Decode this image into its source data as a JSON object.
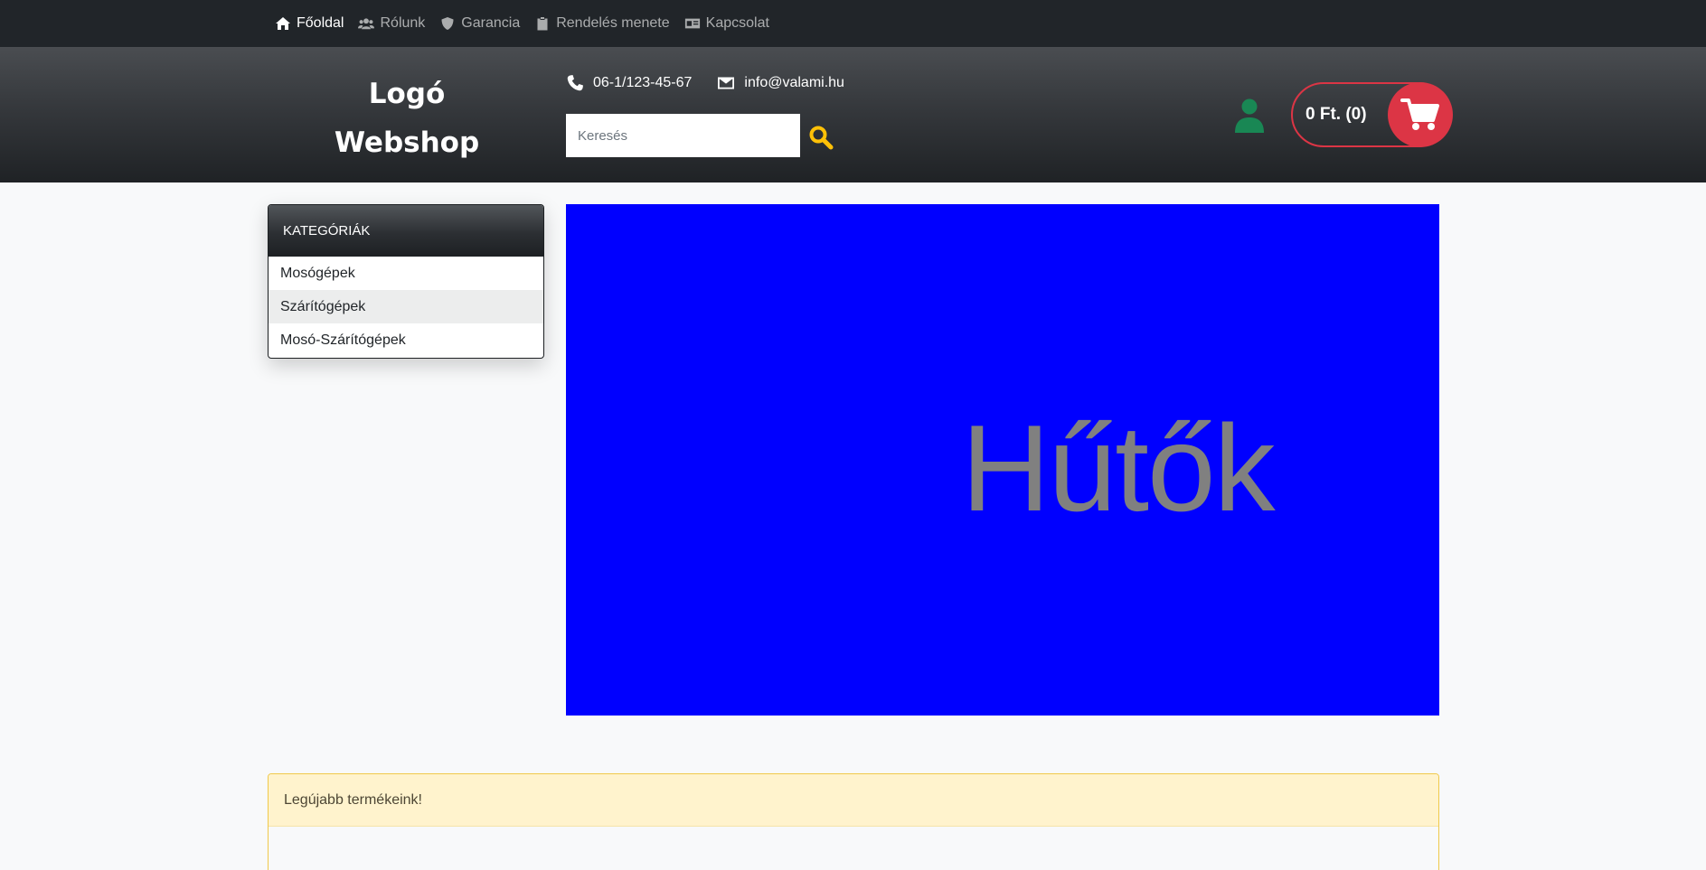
{
  "topnav": {
    "items": [
      {
        "label": "Főoldal",
        "icon": "home-icon",
        "active": true
      },
      {
        "label": "Rólunk",
        "icon": "users-icon"
      },
      {
        "label": "Garancia",
        "icon": "shield-icon"
      },
      {
        "label": "Rendelés menete",
        "icon": "clipboard-icon"
      },
      {
        "label": "Kapcsolat",
        "icon": "id-card-icon"
      }
    ]
  },
  "header": {
    "logo_line1": "Logó",
    "logo_line2": "Webshop",
    "phone": "06-1/123-45-67",
    "email": "info@valami.hu",
    "search_placeholder": "Keresés",
    "search_icon": "search-icon",
    "user_icon": "user-icon",
    "cart_total": "0 Ft. (0)",
    "cart_icon": "shopping-cart-icon"
  },
  "categories": {
    "title": "KATEGÓRIÁK",
    "items": [
      "Mosógépek",
      "Szárítógépek",
      "Mosó-Szárítógépek"
    ]
  },
  "banner": {
    "text": "Hűtők"
  },
  "newest": {
    "title": "Legújabb termékeink!"
  },
  "colors": {
    "topnav_bg": "#212529",
    "accent_red": "#dc3545",
    "accent_yellow": "#ffc107",
    "user_green": "#198754",
    "banner_bg": "#0000ff",
    "banner_text": "#808080",
    "alert_bg": "#fff3cd"
  }
}
